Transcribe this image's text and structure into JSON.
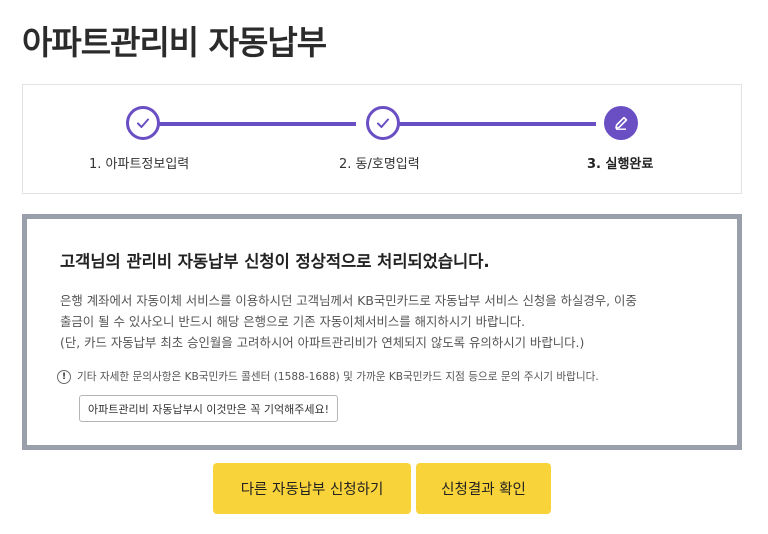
{
  "page": {
    "title": "아파트관리비 자동납부"
  },
  "steps": [
    {
      "label": "1. 아파트정보입력",
      "state": "done",
      "icon": "check-icon"
    },
    {
      "label": "2. 동/호명입력",
      "state": "done",
      "icon": "check-icon"
    },
    {
      "label": "3. 실행완료",
      "state": "active",
      "icon": "pencil-icon"
    }
  ],
  "result": {
    "title": "고객님의 관리비 자동납부 신청이 정상적으로 처리되었습니다.",
    "desc_line1": "은행 계좌에서 자동이체 서비스를 이용하시던 고객님께서 KB국민카드로 자동납부 서비스 신청을 하실경우, 이중",
    "desc_line2": "출금이 될 수 있사오니 반드시 해당 은행으로 기존 자동이체서비스를 해지하시기 바랍니다.",
    "desc_line3": "(단, 카드 자동납부 최초 승인월을 고려하시어 아파트관리비가 연체되지 않도록 유의하시기 바랍니다.)",
    "notice": "기타 자세한 문의사항은 KB국민카드 콜센터 (1588-1688) 및 가까운 KB국민카드 지점 등으로 문의 주시기 바랍니다.",
    "notice_icon": "!",
    "remember_button": "아파트관리비 자동납부시 이것만은 꼭 기억해주세요!"
  },
  "actions": {
    "other_apply": "다른 자동납부 신청하기",
    "check_result": "신청결과 확인"
  },
  "colors": {
    "accent": "#6a4fc4",
    "button": "#f9d33a",
    "box_border": "#999fab"
  }
}
